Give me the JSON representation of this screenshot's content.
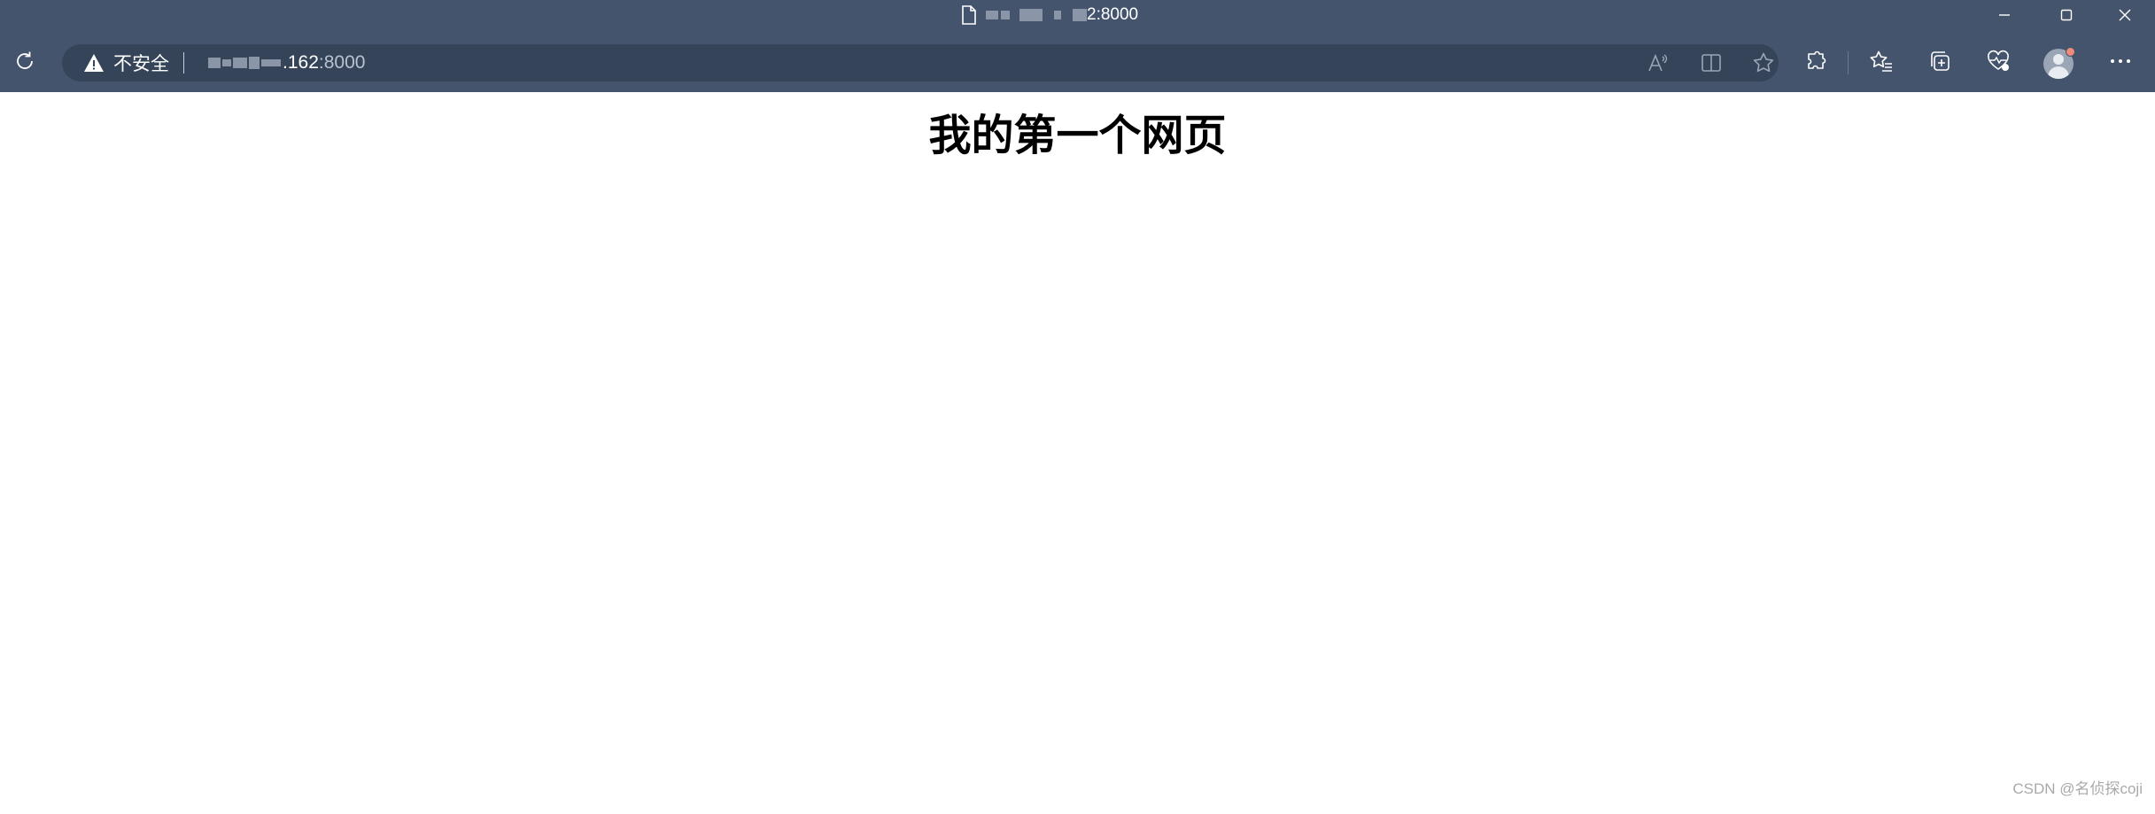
{
  "window": {
    "tab_title": "2:8000",
    "icons": [
      "page-icon",
      "minimize-icon",
      "maximize-icon",
      "close-icon"
    ]
  },
  "toolbar": {
    "refresh_icon": "refresh-icon",
    "security_label": "不安全",
    "url_host": ".162",
    "url_port": ":8000",
    "right_icons": [
      "read-aloud-icon",
      "split-screen-icon",
      "favorite-star-icon",
      "extensions-icon",
      "favorites-icon",
      "collections-icon",
      "browser-essentials-icon",
      "profile-avatar",
      "more-options-icon"
    ]
  },
  "page": {
    "heading": "我的第一个网页",
    "watermark": "CSDN @名侦探coji"
  },
  "colors": {
    "chrome": "#44546c",
    "address_bar": "#36445a",
    "page_bg": "#ffffff"
  }
}
